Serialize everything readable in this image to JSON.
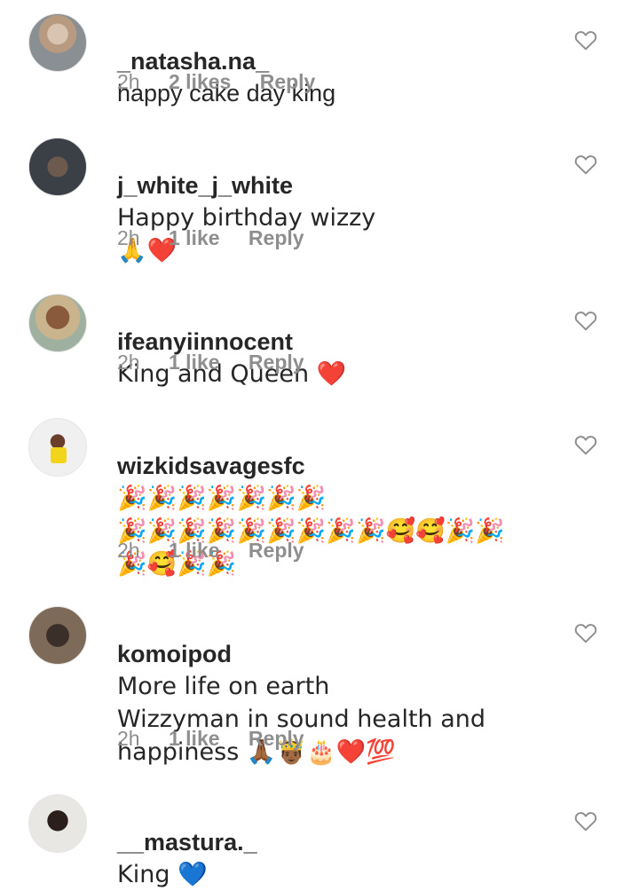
{
  "comments": [
    {
      "username": "_natasha.na_",
      "text": "happy cake day king",
      "time": "2h",
      "likes": "2 likes",
      "reply": "Reply"
    },
    {
      "username": "j_white_j_white",
      "text": "Happy birthday wizzy\n🙏❤️",
      "time": "2h",
      "likes": "1 like",
      "reply": "Reply"
    },
    {
      "username": "ifeanyiinnocent",
      "text": "King and Queen ❤️",
      "time": "2h",
      "likes": "1 like",
      "reply": "Reply"
    },
    {
      "username": "wizkidsavagesfc",
      "text": "🎉🎉🎉🎉🎉🎉🎉\n🎉🎉🎉🎉🎉🎉🎉🎉🎉🥰🥰🎉🎉\n🎉🥰🎉🎉",
      "time": "2h",
      "likes": "1 like",
      "reply": "Reply"
    },
    {
      "username": "komoipod",
      "text": "More life on earth\nWizzyman in sound health and\nhappiness 🙏🏾🤴🏾🎂❤️💯",
      "time": "2h",
      "likes": "1 like",
      "reply": "Reply"
    },
    {
      "username": "__mastura._",
      "text": "King 💙"
    }
  ],
  "icons": {
    "like": "heart-outline-icon"
  },
  "colors": {
    "text": "#262626",
    "meta": "#8e8e8e"
  }
}
